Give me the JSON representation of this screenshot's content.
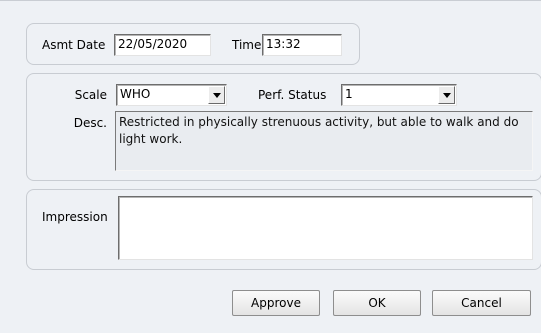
{
  "assessment": {
    "date_label": "Asmt Date",
    "date_value": "22/05/2020",
    "time_label": "Time",
    "time_value": "13:32"
  },
  "scale_section": {
    "scale_label": "Scale",
    "scale_value": "WHO",
    "perf_status_label": "Perf. Status",
    "perf_status_value": "1",
    "desc_label": "Desc.",
    "desc_text": "Restricted in physically strenuous activity, but able to walk and do light work."
  },
  "impression_section": {
    "label": "Impression",
    "value": ""
  },
  "buttons": {
    "approve": "Approve",
    "ok": "OK",
    "cancel": "Cancel"
  },
  "icons": {
    "dropdown": "chevron-down-icon"
  }
}
